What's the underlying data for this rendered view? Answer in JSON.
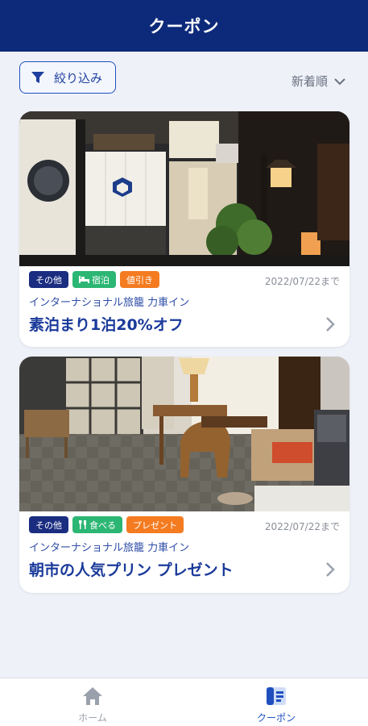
{
  "header": {
    "title": "クーポン"
  },
  "toolbar": {
    "filter_label": "絞り込み",
    "filter_icon": "filter-icon",
    "sort_label": "新着順",
    "sort_icon": "chevron-down-icon"
  },
  "coupons": [
    {
      "tags": [
        {
          "label": "その他",
          "color": "#1a2d80",
          "icon": ""
        },
        {
          "label": "宿泊",
          "color": "#2bb673",
          "icon": "bed-icon"
        },
        {
          "label": "値引き",
          "color": "#f47b20",
          "icon": ""
        }
      ],
      "date": "2022/07/22まで",
      "hotel": "インターナショナル旅籠 力車イン",
      "title": "素泊まり1泊20%オフ",
      "photo": "ryokan-entrance-photo"
    },
    {
      "tags": [
        {
          "label": "その他",
          "color": "#1a2d80",
          "icon": ""
        },
        {
          "label": "食べる",
          "color": "#2bb673",
          "icon": "food-icon"
        },
        {
          "label": "プレゼント",
          "color": "#f47b20",
          "icon": ""
        }
      ],
      "date": "2022/07/22まで",
      "hotel": "インターナショナル旅籠 力車イン",
      "title": "朝市の人気プリン プレゼント",
      "photo": "ryokan-lounge-photo"
    }
  ],
  "bottom_nav": {
    "items": [
      {
        "label": "ホーム",
        "icon": "home-icon",
        "active": false
      },
      {
        "label": "クーポン",
        "icon": "coupon-icon",
        "active": true
      }
    ]
  },
  "colors": {
    "header_bg": "#0d2a7a",
    "accent": "#1f4fbf",
    "page_bg": "#eef1f8"
  }
}
